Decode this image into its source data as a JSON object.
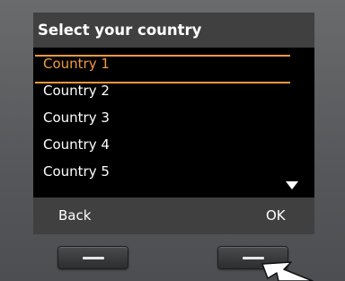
{
  "screen": {
    "title": "Select your country",
    "items": [
      {
        "label": "Country 1",
        "selected": true
      },
      {
        "label": "Country 2",
        "selected": false
      },
      {
        "label": "Country 3",
        "selected": false
      },
      {
        "label": "Country 4",
        "selected": false
      },
      {
        "label": "Country 5",
        "selected": false
      }
    ],
    "scroll_indicator_icon": "triangle-down-icon"
  },
  "softkeys": {
    "left_label": "Back",
    "right_label": "OK"
  },
  "colors": {
    "accent": "#f39a3c",
    "screen_background": "#000000",
    "bar_background": "#404040",
    "bezel": "#5a5b5d"
  }
}
